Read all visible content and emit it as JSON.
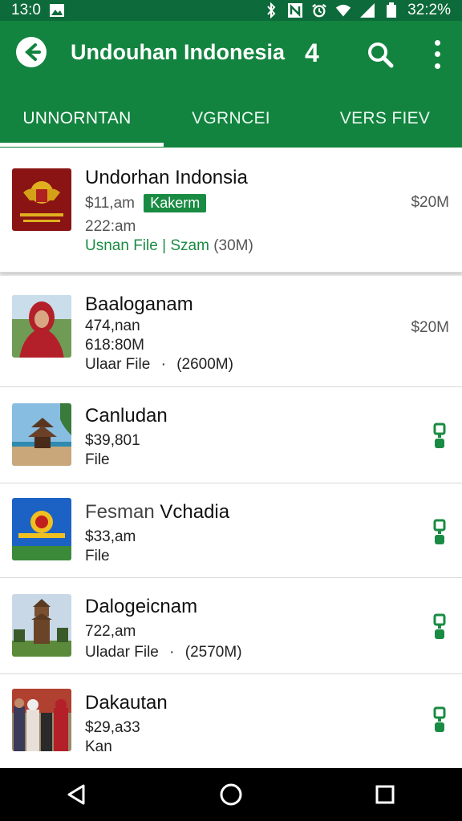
{
  "status_bar": {
    "time": "13:0",
    "battery": "32:2%",
    "icons": [
      "gallery-icon",
      "bluetooth-icon",
      "nfc-icon",
      "alarm-icon",
      "wifi-icon",
      "signal-icon",
      "battery-icon"
    ]
  },
  "app_bar": {
    "title": "Undouhan Indonesia",
    "count": "4",
    "icons": [
      "back-arrow-icon",
      "search-icon",
      "more-vert-icon"
    ]
  },
  "tabs": [
    {
      "label": "UNNORNTAN",
      "active": true
    },
    {
      "label": "VGRNCEI",
      "active": false
    },
    {
      "label": "VERS FIEV",
      "active": false
    }
  ],
  "items": [
    {
      "title": "Undorhan Indonsia",
      "line1": "$11,am",
      "badge": "Kakerm",
      "line2": "222:am",
      "file_label": "Usnan File",
      "separator": "|",
      "file_extra": "Szam",
      "file_size": "(30M)",
      "price": "$20M",
      "thumb": "emblem"
    },
    {
      "title": "Baaloganam",
      "line1": "474,nan",
      "line2": "618:80M",
      "file_label": "Ulaar File",
      "separator": "·",
      "file_size": "(2600M)",
      "price": "$20M",
      "thumb": "person"
    },
    {
      "title": "Canludan",
      "line1": "$39,801",
      "line2": "File",
      "thumb": "temple"
    },
    {
      "title_part1": "Fesman",
      "title_part2": "Vchadia",
      "line1": "$33,am",
      "line2": "File",
      "thumb": "poster"
    },
    {
      "title": "Dalogeicnam",
      "line1": "722,am",
      "file_label": "Uladar File",
      "separator": "·",
      "file_size": "(2570M)",
      "thumb": "tower"
    },
    {
      "title": "Dakautan",
      "line1": "$29,a33",
      "line2": "Kan",
      "thumb": "group"
    }
  ],
  "nav_bar": {
    "icons": [
      "back-triangle-icon",
      "home-circle-icon",
      "recents-square-icon"
    ]
  },
  "colors": {
    "primary": "#12843f",
    "status_bar": "#0d6a3a",
    "accent": "#1a8b43"
  }
}
